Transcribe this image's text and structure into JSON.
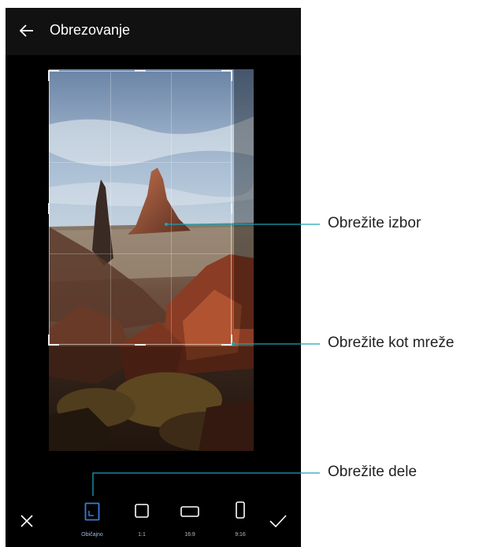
{
  "header": {
    "title": "Obrezovanje"
  },
  "toolbar": {
    "tools": [
      {
        "label": "Običajno"
      },
      {
        "label": "1:1"
      },
      {
        "label": "16:9"
      },
      {
        "label": "9:16"
      }
    ]
  },
  "callouts": {
    "crop_selection": "Obrežite izbor",
    "grid_corner": "Obrežite kot mreže",
    "ratios": "Obrežite dele"
  },
  "colors": {
    "callout_line": "#1aa3b8",
    "active_tool": "#3b7bd8",
    "screen_bg": "#000000"
  }
}
